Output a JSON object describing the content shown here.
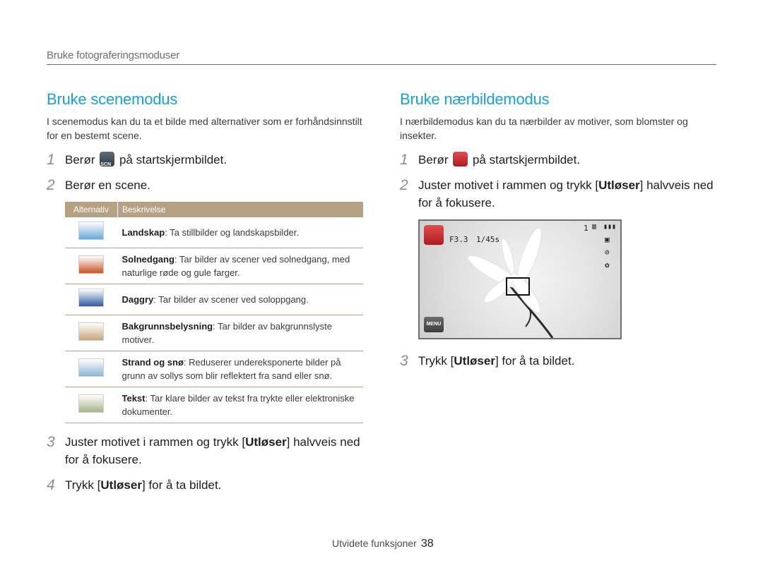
{
  "header": {
    "section": "Bruke fotograferingsmoduser"
  },
  "left": {
    "title": "Bruke scenemodus",
    "intro": "I scenemodus kan du ta et bilde med alternativer som er forhåndsinnstilt for en bestemt scene.",
    "step1": {
      "num": "1",
      "pre": "Berør",
      "post": "på startskjermbildet."
    },
    "step2": {
      "num": "2",
      "text": "Berør en scene."
    },
    "table": {
      "col_option": "Alternativ",
      "col_desc": "Beskrivelse",
      "rows": [
        {
          "name": "Landskap",
          "desc": ": Ta stillbilder og landskapsbilder.",
          "thumb_color": "#6aa6d8"
        },
        {
          "name": "Solnedgang",
          "desc": ": Tar bilder av scener ved solnedgang, med naturlige røde og gule farger.",
          "thumb_color": "#c8552a"
        },
        {
          "name": "Daggry",
          "desc": ": Tar bilder av scener ved soloppgang.",
          "thumb_color": "#2f5aa0"
        },
        {
          "name": "Bakgrunnsbelysning",
          "desc": ": Tar bilder av bakgrunnslyste motiver.",
          "thumb_color": "#c9a578"
        },
        {
          "name": "Strand og snø",
          "desc": ": Reduserer undereksponerte bilder på grunn av sollys som blir reflektert fra sand eller snø.",
          "thumb_color": "#8fb3d6"
        },
        {
          "name": "Tekst",
          "desc": ": Tar klare bilder av tekst fra trykte eller elektroniske dokumenter.",
          "thumb_color": "#a5b58a"
        }
      ]
    },
    "step3": {
      "num": "3",
      "pre": "Juster motivet i rammen og trykk [",
      "key": "Utløser",
      "post": "] halvveis ned for å fokusere."
    },
    "step4": {
      "num": "4",
      "pre": "Trykk [",
      "key": "Utløser",
      "post": "] for å ta bildet."
    }
  },
  "right": {
    "title": "Bruke nærbildemodus",
    "intro": "I nærbildemodus kan du ta nærbilder av motiver, som blomster og insekter.",
    "step1": {
      "num": "1",
      "pre": "Berør",
      "post": "på startskjermbildet."
    },
    "step2": {
      "num": "2",
      "pre": "Juster motivet i rammen og trykk [",
      "key": "Utløser",
      "post": "] halvveis ned for å fokusere."
    },
    "camera": {
      "aperture": "F3.3",
      "shutter": "1/45s",
      "shots": "1",
      "menu": "MENU"
    },
    "step3": {
      "num": "3",
      "pre": "Trykk [",
      "key": "Utløser",
      "post": "] for å ta bildet."
    }
  },
  "footer": {
    "label": "Utvidete funksjoner",
    "page": "38"
  }
}
